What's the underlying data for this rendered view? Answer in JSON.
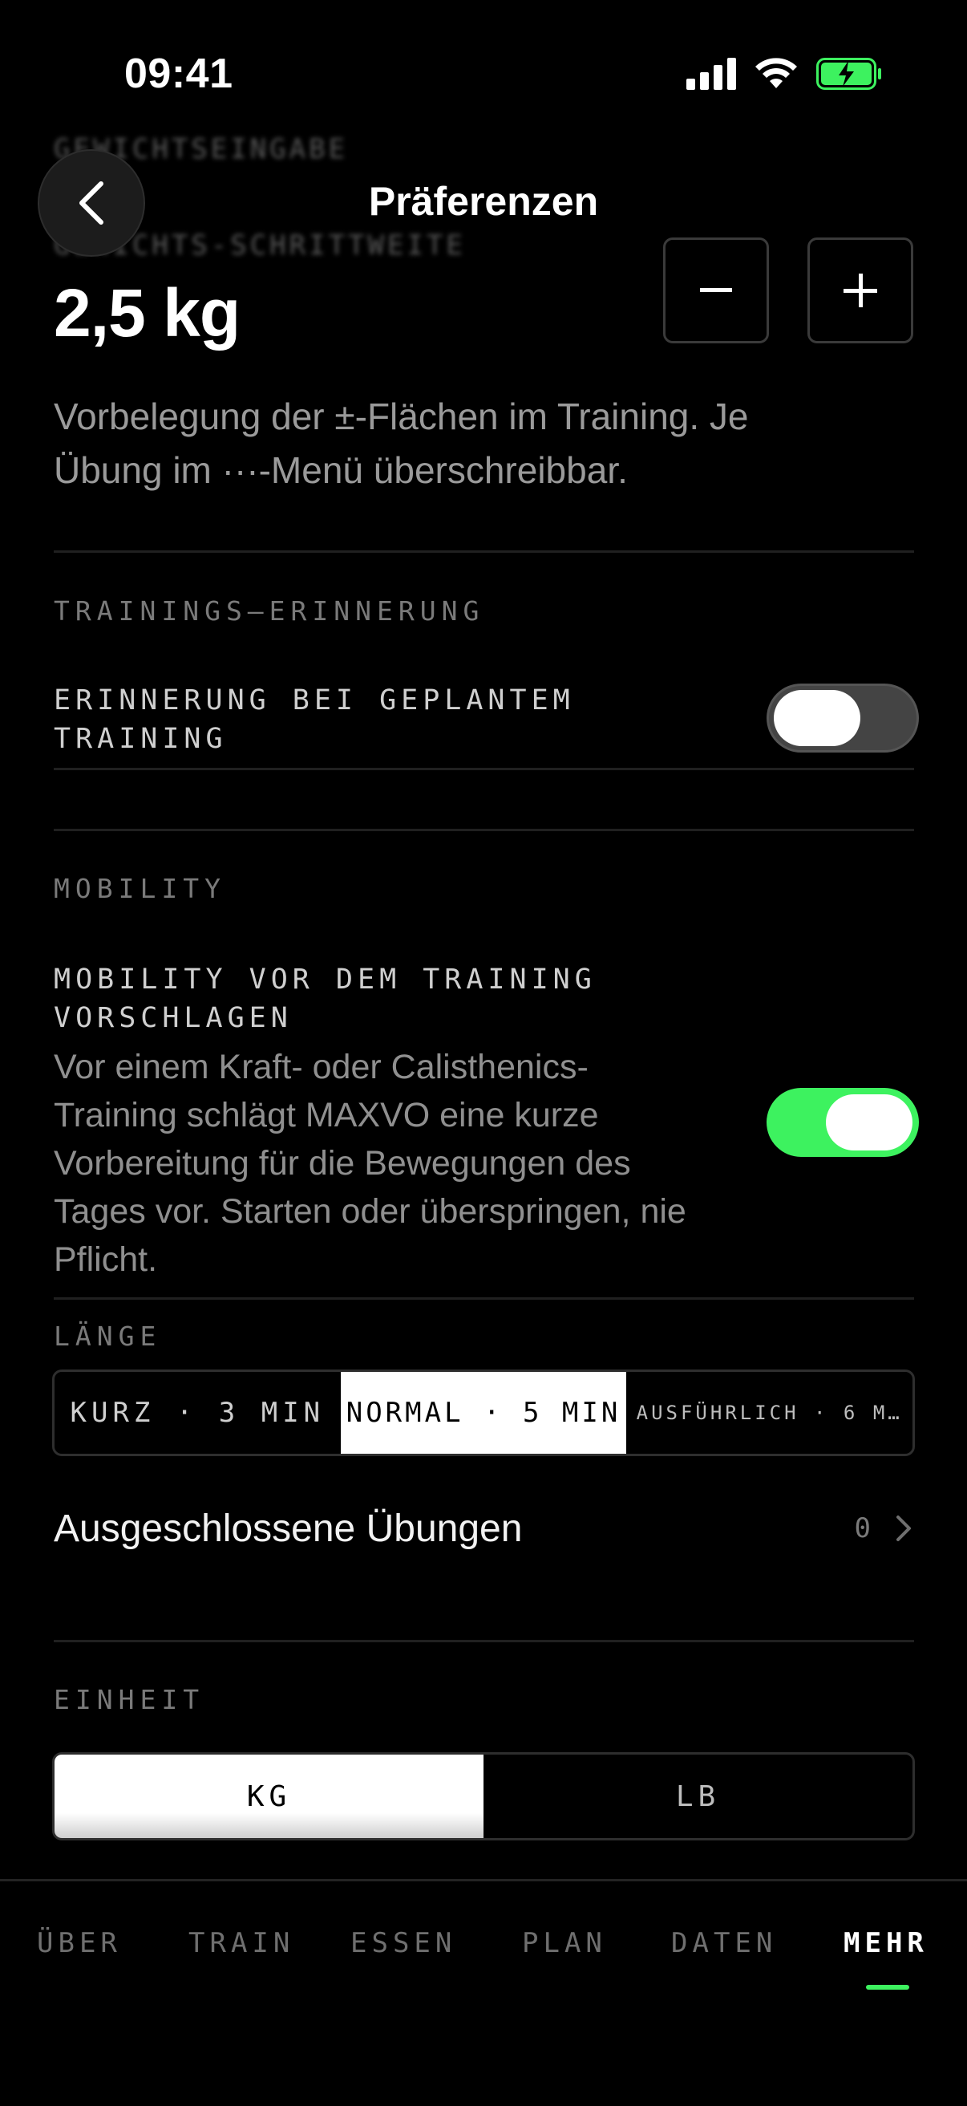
{
  "status_bar": {
    "time": "09:41"
  },
  "ghost": {
    "line1": "GEWICHTSEINGABE",
    "line2": "GEWICHTS-SCHRITTWEITE"
  },
  "header": {
    "title": "Präferenzen"
  },
  "weight_step": {
    "value": "2,5 kg",
    "minus": "−",
    "plus": "+",
    "description": "Vorbelegung der ±-Flächen im Training. Je Übung im ···-Menü überschreibbar."
  },
  "training_reminder": {
    "section": "TRAININGS–ERINNERUNG",
    "label_line1": "ERINNERUNG BEI GEPLANTEM",
    "label_line2": "TRAINING",
    "enabled": false
  },
  "mobility": {
    "section": "MOBILITY",
    "label_line1": "MOBILITY VOR DEM TRAINING",
    "label_line2": "VORSCHLAGEN",
    "description": "Vor einem Kraft- oder Calisthenics-Training schlägt MAXVO eine kurze Vorbereitung für die Bewegungen des Tages vor. Starten oder überspringen, nie Pflicht.",
    "enabled": true,
    "length_label": "LÄNGE",
    "length_options": [
      "KURZ · 3 MIN",
      "NORMAL · 5 MIN",
      "AUSFÜHRLICH · 6 M…"
    ],
    "length_selected": "NORMAL · 5 MIN"
  },
  "excluded": {
    "title": "Ausgeschlossene Übungen",
    "count": "0"
  },
  "unit": {
    "section": "EINHEIT",
    "options": [
      "KG",
      "LB"
    ],
    "selected": "KG"
  },
  "tabbar": {
    "tabs": [
      "ÜBER",
      "TRAIN",
      "ESSEN",
      "PLAN",
      "DATEN",
      "MEHR"
    ],
    "active": "MEHR"
  },
  "colors": {
    "accent": "#3df25f",
    "background": "#000000"
  }
}
